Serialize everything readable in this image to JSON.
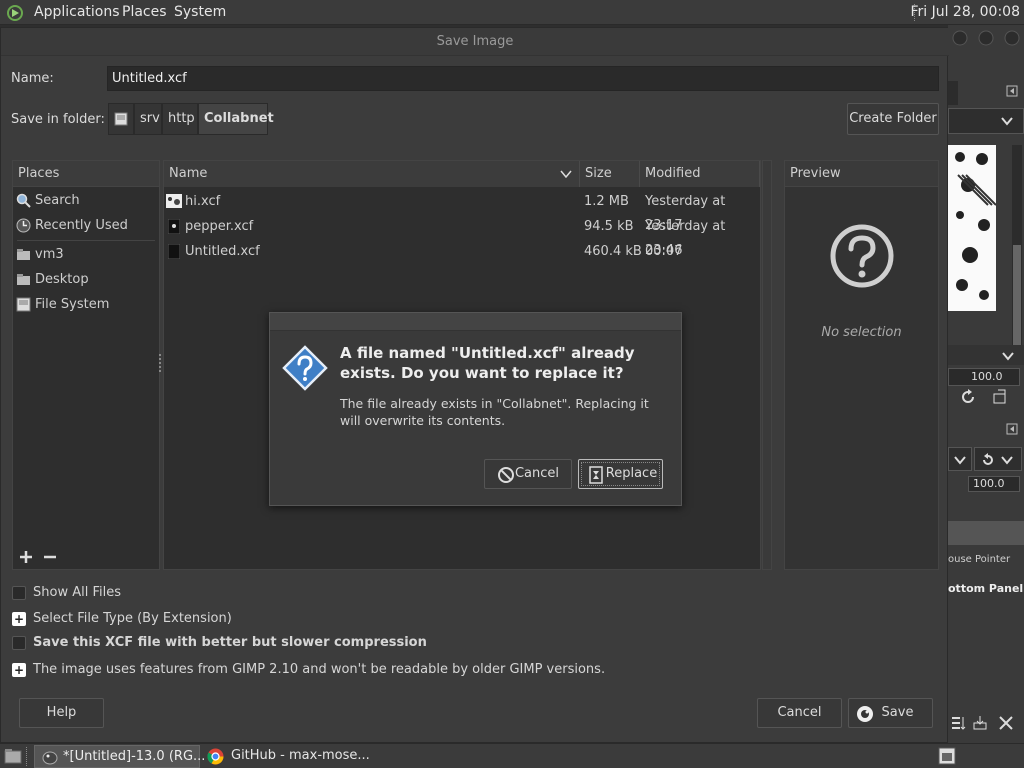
{
  "top_panel": {
    "applications": "Applications",
    "places": "Places",
    "system": "System",
    "clock": "Fri Jul 28, 00:08"
  },
  "dialog": {
    "title": "Save Image",
    "name_label": "Name:",
    "name_value": "Untitled.xcf",
    "folder_label": "Save in folder:",
    "breadcrumbs": [
      "srv",
      "http",
      "Collabnet"
    ],
    "create_folder": "Create Folder"
  },
  "places": {
    "header": "Places",
    "items": [
      "Search",
      "Recently Used",
      "vm3",
      "Desktop",
      "File System"
    ]
  },
  "files": {
    "col_name": "Name",
    "col_size": "Size",
    "col_modified": "Modified",
    "rows": [
      {
        "name": "hi.xcf",
        "size": "1.2 MB",
        "modified": "Yesterday at 23:17"
      },
      {
        "name": "pepper.xcf",
        "size": "94.5 kB",
        "modified": "Yesterday at 23:46"
      },
      {
        "name": "Untitled.xcf",
        "size": "460.4 kB",
        "modified": "00:07"
      }
    ]
  },
  "preview": {
    "header": "Preview",
    "no_selection": "No selection"
  },
  "options": {
    "show_all_files": "Show All Files",
    "select_file_type": "Select File Type (By Extension)",
    "better_compression": "Save this XCF file with better but slower compression",
    "compat_note": "The image uses features from GIMP 2.10 and won't be readable by older GIMP versions."
  },
  "buttons": {
    "help": "Help",
    "cancel": "Cancel",
    "save": "Save"
  },
  "confirm": {
    "heading": "A file named \"Untitled.xcf\" already exists.  Do you want to replace it?",
    "body": "The file already exists in \"Collabnet\".  Replacing it will overwrite its contents.",
    "cancel": "Cancel",
    "replace": "Replace"
  },
  "gimp_strip": {
    "value1": "100.0",
    "value2": "100.0",
    "mouse_pointer": "ouse Pointer",
    "bottom_panel": "ottom Panel"
  },
  "taskbar": {
    "gimp_task": "*[Untitled]-13.0 (RG...",
    "browser_task": "GitHub - max-mose..."
  }
}
